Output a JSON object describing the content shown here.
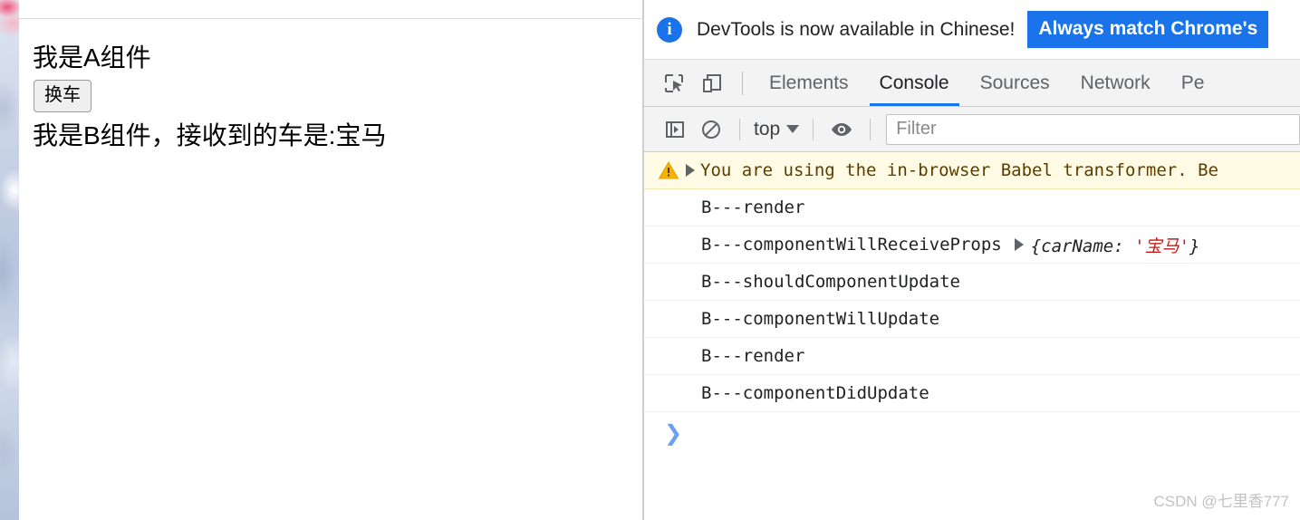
{
  "page": {
    "component_a_text": "我是A组件",
    "swap_button_label": "换车",
    "component_b_text": "我是B组件，接收到的车是:宝马"
  },
  "devtools": {
    "banner": {
      "icon": "info-icon",
      "message": "DevTools is now available in Chinese!",
      "primary_button": "Always match Chrome's"
    },
    "toolbar_icons": [
      {
        "name": "inspect-element-icon"
      },
      {
        "name": "device-toolbar-icon"
      }
    ],
    "tabs": [
      {
        "label": "Elements",
        "active": false
      },
      {
        "label": "Console",
        "active": true
      },
      {
        "label": "Sources",
        "active": false
      },
      {
        "label": "Network",
        "active": false
      },
      {
        "label": "Pe",
        "active": false
      }
    ],
    "console_toolbar": {
      "sidebar_icon": "console-sidebar-icon",
      "clear_icon": "clear-console-icon",
      "context": "top",
      "eye_icon": "live-expression-eye-icon",
      "filter_placeholder": "Filter",
      "filter_value": ""
    },
    "messages": [
      {
        "level": "warning",
        "icon": "warning-triangle-icon",
        "expandable": true,
        "text": "You are using the in-browser Babel transformer. Be"
      },
      {
        "level": "log",
        "expandable": false,
        "text": "B---render"
      },
      {
        "level": "log",
        "expandable": false,
        "text": "B---componentWillReceiveProps",
        "object_disclosure": true,
        "object_open": "{carName: ",
        "object_string": "'宝马'",
        "object_close": "}"
      },
      {
        "level": "log",
        "expandable": false,
        "text": "B---shouldComponentUpdate"
      },
      {
        "level": "log",
        "expandable": false,
        "text": "B---componentWillUpdate"
      },
      {
        "level": "log",
        "expandable": false,
        "text": "B---render"
      },
      {
        "level": "log",
        "expandable": false,
        "text": "B---componentDidUpdate"
      }
    ],
    "prompt": {
      "chevron": "❯"
    }
  },
  "watermark": "CSDN @七里香777",
  "colors": {
    "accent_blue": "#1a73e8",
    "warning_bg": "#fffbe5",
    "warning_amber": "#f5b400",
    "string_red": "#c41a16",
    "prompt_blue": "#6b9ef5"
  }
}
